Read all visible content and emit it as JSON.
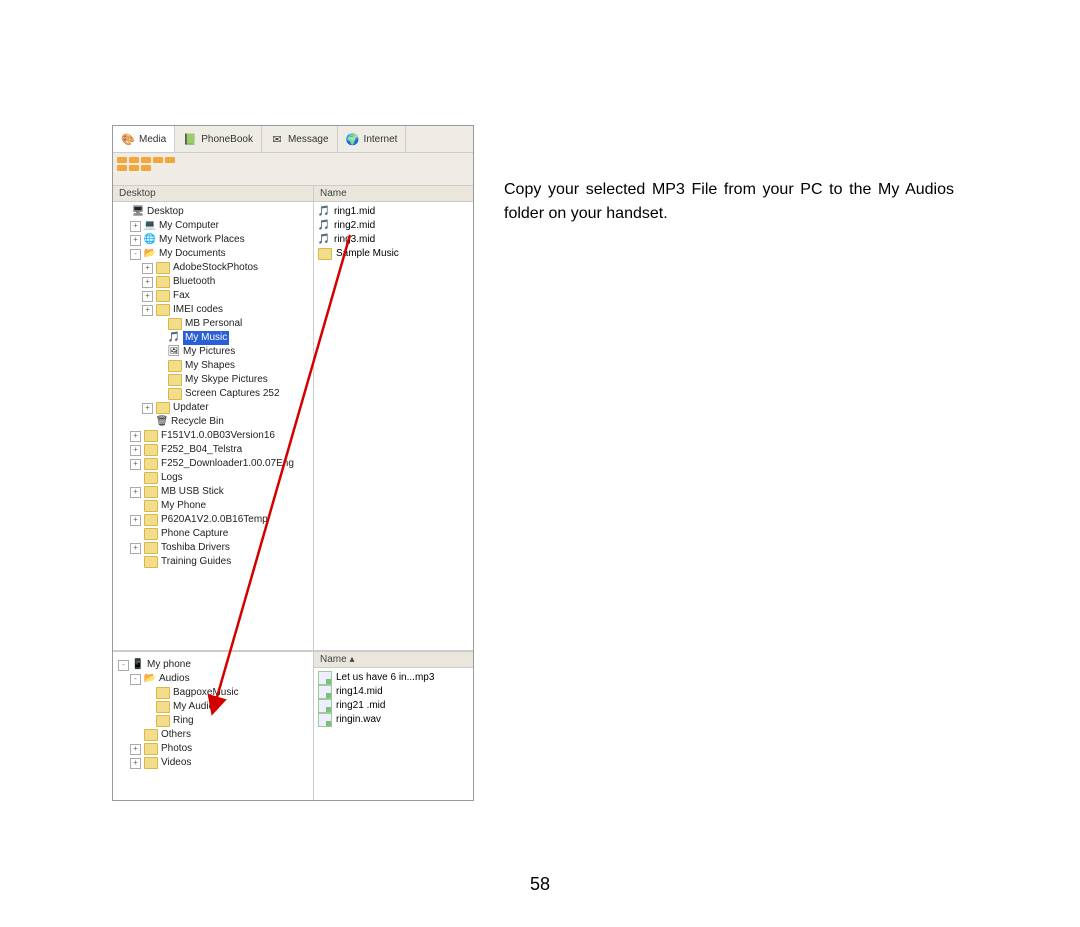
{
  "tabs": {
    "media": "Media",
    "phonebook": "PhoneBook",
    "message": "Message",
    "internet": "Internet"
  },
  "top_header_left": "Desktop",
  "top_header_right": "Name",
  "tree_top": [
    {
      "indent": 0,
      "exp": "",
      "type": "spec",
      "glyph": "🖥",
      "label": "Desktop"
    },
    {
      "indent": 1,
      "exp": "+",
      "type": "spec",
      "glyph": "💻",
      "label": "My Computer"
    },
    {
      "indent": 1,
      "exp": "+",
      "type": "spec",
      "glyph": "🌐",
      "label": "My Network Places"
    },
    {
      "indent": 1,
      "exp": "-",
      "type": "spec",
      "glyph": "📂",
      "label": "My Documents"
    },
    {
      "indent": 2,
      "exp": "+",
      "type": "fld",
      "label": "AdobeStockPhotos"
    },
    {
      "indent": 2,
      "exp": "+",
      "type": "fld",
      "label": "Bluetooth"
    },
    {
      "indent": 2,
      "exp": "+",
      "type": "fld",
      "label": "Fax"
    },
    {
      "indent": 2,
      "exp": "+",
      "type": "fld",
      "label": "IMEI codes"
    },
    {
      "indent": 3,
      "exp": "",
      "type": "fld",
      "label": "MB Personal"
    },
    {
      "indent": 3,
      "exp": "",
      "type": "spec",
      "glyph": "🎵",
      "label": "My Music",
      "hl": true
    },
    {
      "indent": 3,
      "exp": "",
      "type": "spec",
      "glyph": "🖼",
      "label": "My Pictures"
    },
    {
      "indent": 3,
      "exp": "",
      "type": "fld",
      "label": "My Shapes"
    },
    {
      "indent": 3,
      "exp": "",
      "type": "fld",
      "label": "My Skype Pictures"
    },
    {
      "indent": 3,
      "exp": "",
      "type": "fld",
      "label": "Screen Captures 252"
    },
    {
      "indent": 2,
      "exp": "+",
      "type": "fld",
      "label": "Updater"
    },
    {
      "indent": 2,
      "exp": "",
      "type": "spec",
      "glyph": "🗑",
      "label": "Recycle Bin"
    },
    {
      "indent": 1,
      "exp": "+",
      "type": "fld",
      "label": "F151V1.0.0B03Version16"
    },
    {
      "indent": 1,
      "exp": "+",
      "type": "fld",
      "label": "F252_B04_Telstra"
    },
    {
      "indent": 1,
      "exp": "+",
      "type": "fld",
      "label": "F252_Downloader1.00.07Eng"
    },
    {
      "indent": 1,
      "exp": "",
      "type": "fld",
      "label": "Logs"
    },
    {
      "indent": 1,
      "exp": "+",
      "type": "fld",
      "label": "MB USB Stick"
    },
    {
      "indent": 1,
      "exp": "",
      "type": "fld",
      "label": "My Phone"
    },
    {
      "indent": 1,
      "exp": "+",
      "type": "fld",
      "label": "P620A1V2.0.0B16Temp"
    },
    {
      "indent": 1,
      "exp": "",
      "type": "fld",
      "label": "Phone Capture"
    },
    {
      "indent": 1,
      "exp": "+",
      "type": "fld",
      "label": "Toshiba Drivers"
    },
    {
      "indent": 1,
      "exp": "",
      "type": "fld",
      "label": "Training Guides"
    }
  ],
  "files_top": [
    {
      "type": "mid",
      "name": "ring1.mid"
    },
    {
      "type": "mid",
      "name": "ring2.mid"
    },
    {
      "type": "mid",
      "name": "ring3.mid"
    },
    {
      "type": "fld",
      "name": "Sample Music"
    }
  ],
  "bottom_header_left": "",
  "bottom_header_right": "Name   ▴",
  "tree_bottom": [
    {
      "indent": 0,
      "exp": "-",
      "type": "spec",
      "glyph": "📱",
      "label": "My phone"
    },
    {
      "indent": 1,
      "exp": "-",
      "type": "spec",
      "glyph": "📂",
      "label": "Audios"
    },
    {
      "indent": 2,
      "exp": "",
      "type": "fld",
      "label": "BagpoxeMusic"
    },
    {
      "indent": 2,
      "exp": "",
      "type": "fld",
      "label": "My Audios"
    },
    {
      "indent": 2,
      "exp": "",
      "type": "fld",
      "label": "Ring"
    },
    {
      "indent": 1,
      "exp": "",
      "type": "fld",
      "label": "Others"
    },
    {
      "indent": 1,
      "exp": "+",
      "type": "fld",
      "label": "Photos"
    },
    {
      "indent": 1,
      "exp": "+",
      "type": "fld",
      "label": "Videos"
    }
  ],
  "files_bottom": [
    {
      "type": "gr",
      "name": "Let us have 6 in...mp3"
    },
    {
      "type": "gr",
      "name": "ring14.mid"
    },
    {
      "type": "gr",
      "name": "ring21 .mid"
    },
    {
      "type": "gr",
      "name": "ringin.wav"
    }
  ],
  "caption": "Copy your selected MP3 File from your PC to the My Audios folder on your handset.",
  "page_number": "58",
  "icon_glyphs": {
    "media": "🎨",
    "phonebook": "📗",
    "message": "✉",
    "internet": "🌍",
    "music": "🎵"
  }
}
